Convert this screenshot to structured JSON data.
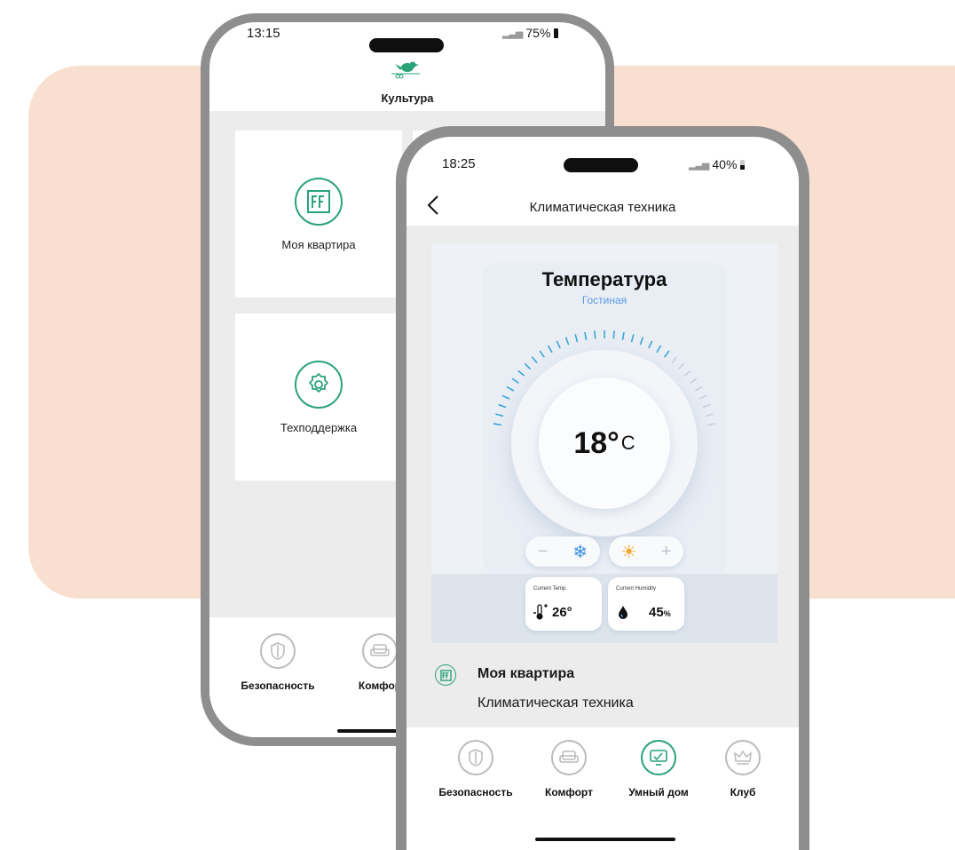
{
  "colors": {
    "accent": "#2aa277",
    "peach": "#f8dfcf",
    "frame": "#8e8e8e",
    "therm_blue": "#5b9ae0"
  },
  "phone_back": {
    "status": {
      "time": "13:15",
      "battery": "75%"
    },
    "header": {
      "title": "Культура",
      "logo_icon": "bird-logo-icon"
    },
    "tiles": [
      {
        "label": "Моя квартира",
        "icon": "ff-apartment-icon"
      },
      {
        "label": "Техподдержка",
        "icon": "gear-support-icon"
      }
    ],
    "nav": [
      {
        "label": "Безопасность",
        "icon": "shield-icon"
      },
      {
        "label": "Комфор",
        "icon": "armchair-icon"
      }
    ]
  },
  "phone_front": {
    "status": {
      "time": "18:25",
      "battery": "40%"
    },
    "header": {
      "title": "Климатическая техника",
      "back_icon": "chevron-left-icon"
    },
    "thermostat": {
      "title": "Температура",
      "room": "Гостиная",
      "temperature": "18°",
      "unit": "C",
      "minus": "−",
      "plus": "+",
      "current_temp": {
        "label": "Current Temp.",
        "value": "26°"
      },
      "current_humidity": {
        "label": "Current Humidity",
        "value": "45",
        "unit": "%"
      }
    },
    "info": {
      "title": "Моя квартира",
      "subtitle": "Климатическая техника",
      "icon": "ff-apartment-icon"
    },
    "nav": [
      {
        "label": "Безопасность",
        "icon": "shield-icon",
        "active": false
      },
      {
        "label": "Комфорт",
        "icon": "armchair-icon",
        "active": false
      },
      {
        "label": "Умный дом",
        "icon": "smart-home-monitor-icon",
        "active": true
      },
      {
        "label": "Клуб",
        "icon": "crown-icon",
        "active": false
      }
    ]
  }
}
